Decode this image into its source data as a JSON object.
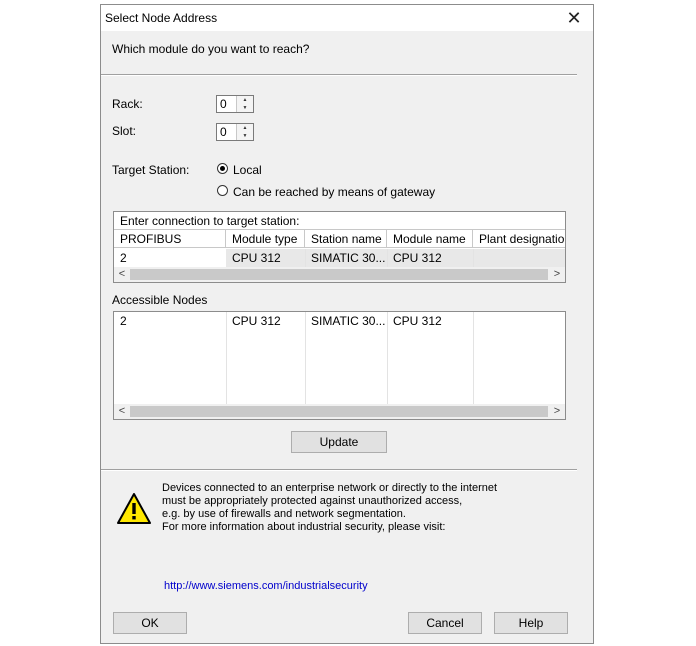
{
  "dialog": {
    "title": "Select Node Address",
    "close_glyph": "✕",
    "question": "Which module do you want to reach?"
  },
  "rack": {
    "label": "Rack:",
    "value": "0"
  },
  "slot": {
    "label": "Slot:",
    "value": "0"
  },
  "target_station": {
    "label": "Target Station:",
    "options": [
      "Local",
      "Can be reached by means of gateway"
    ],
    "selected": "Local"
  },
  "connection_table": {
    "caption": "Enter connection to target station:",
    "columns": [
      "PROFIBUS address",
      "Module type",
      "Station name",
      "Module name",
      "Plant designation"
    ],
    "rows": [
      [
        "2",
        "CPU 312",
        "SIMATIC 30...",
        "CPU 312",
        ""
      ]
    ]
  },
  "accessible_nodes": {
    "label": "Accessible Nodes",
    "rows": [
      [
        "2",
        "CPU 312",
        "SIMATIC 30...",
        "CPU 312",
        ""
      ]
    ]
  },
  "buttons": {
    "update": "Update",
    "ok": "OK",
    "cancel": "Cancel",
    "help": "Help"
  },
  "warning": {
    "icon": "warning-icon",
    "lines": [
      "Devices connected to an enterprise network or directly to the internet",
      "must be appropriately  protected against unauthorized access,",
      "e.g. by use of firewalls and network segmentation.",
      "For more information about industrial security, please visit:"
    ],
    "link": "http://www.siemens.com/industrialsecurity"
  },
  "colors": {
    "link": "#0000cc",
    "warning_yellow": "#ffe800"
  }
}
